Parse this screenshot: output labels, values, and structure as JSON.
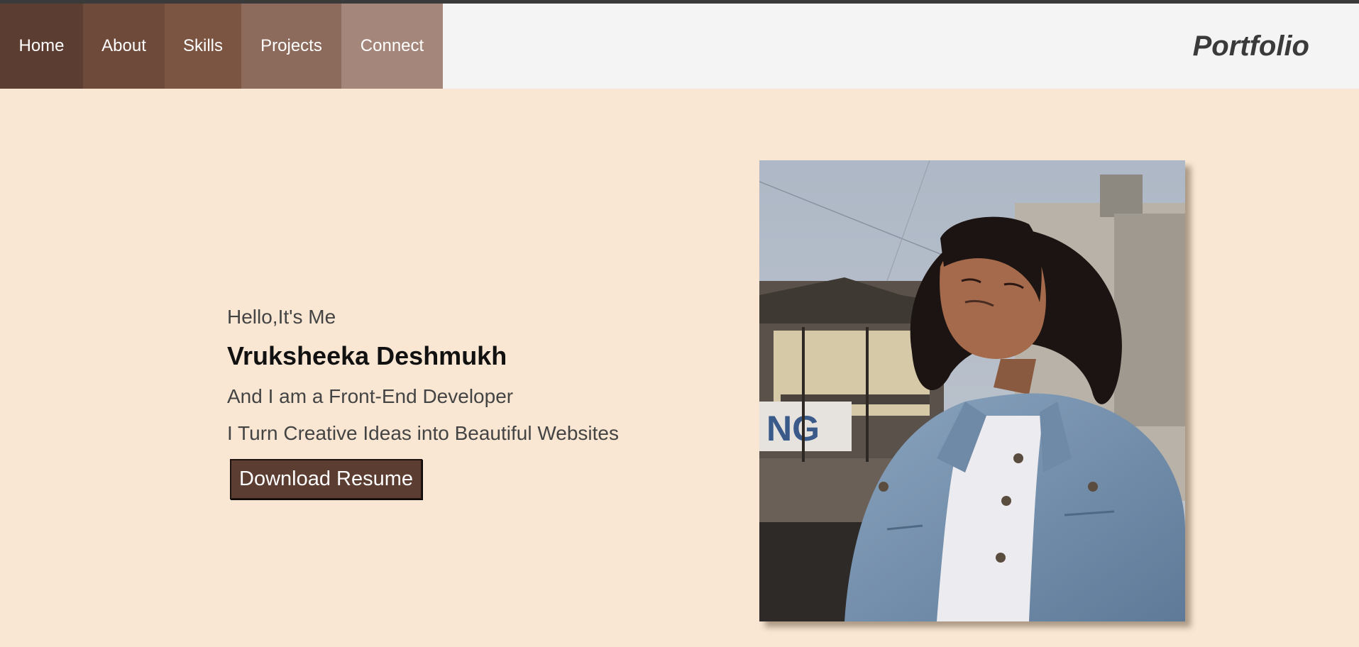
{
  "nav": {
    "items": [
      {
        "label": "Home"
      },
      {
        "label": "About"
      },
      {
        "label": "Skills"
      },
      {
        "label": "Projects"
      },
      {
        "label": "Connect"
      }
    ]
  },
  "brand": {
    "title": "Portfolio"
  },
  "hero": {
    "greeting": "Hello,It's Me",
    "name": "Vruksheeka Deshmukh",
    "role": "And I am a Front-End Developer",
    "tagline": "I Turn Creative Ideas into Beautiful Websites",
    "resume_button": "Download Resume"
  },
  "colors": {
    "background": "#f9e7d4",
    "header_bg": "#f4f4f4",
    "accent": "#5b3d31"
  }
}
